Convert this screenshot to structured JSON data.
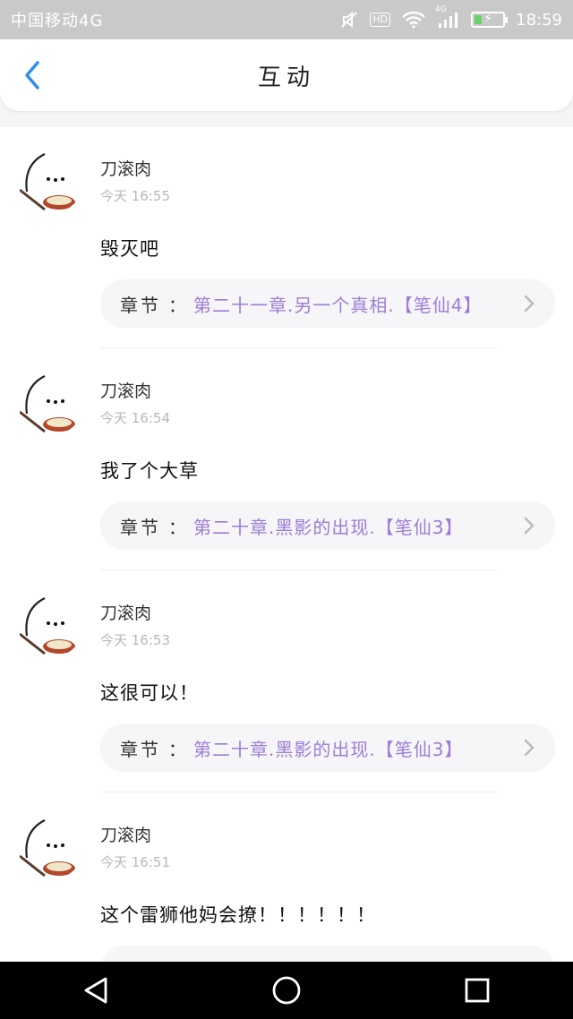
{
  "status_bar": {
    "carrier": "中国移动4G",
    "network_badge": "4G",
    "hd_badge": "HD",
    "time": "18:59"
  },
  "header": {
    "title": "互动"
  },
  "chapter_label": "章节",
  "chapter_colon": "：",
  "comments": [
    {
      "name": "刀滚肉",
      "time": "今天 16:55",
      "content": "毁灭吧",
      "chapter": "第二十一章.另一个真相.【笔仙4】"
    },
    {
      "name": "刀滚肉",
      "time": "今天 16:54",
      "content": "我了个大草",
      "chapter": "第二十章.黑影的出现.【笔仙3】"
    },
    {
      "name": "刀滚肉",
      "time": "今天 16:53",
      "content": "这很可以！",
      "chapter": "第二十章.黑影的出现.【笔仙3】"
    },
    {
      "name": "刀滚肉",
      "time": "今天 16:51",
      "content": "这个雷狮他妈会撩！！！！！！",
      "chapter": ""
    }
  ],
  "colors": {
    "accent": "#2f8cf0",
    "chapter_text": "#9c7cd6",
    "status_bar": "#c9c9c9"
  },
  "icons": {
    "back": "back-arrow-icon",
    "chevron": "chevron-right-icon",
    "nav_back": "nav-back-icon",
    "nav_home": "nav-home-icon",
    "nav_recent": "nav-recent-icon"
  }
}
